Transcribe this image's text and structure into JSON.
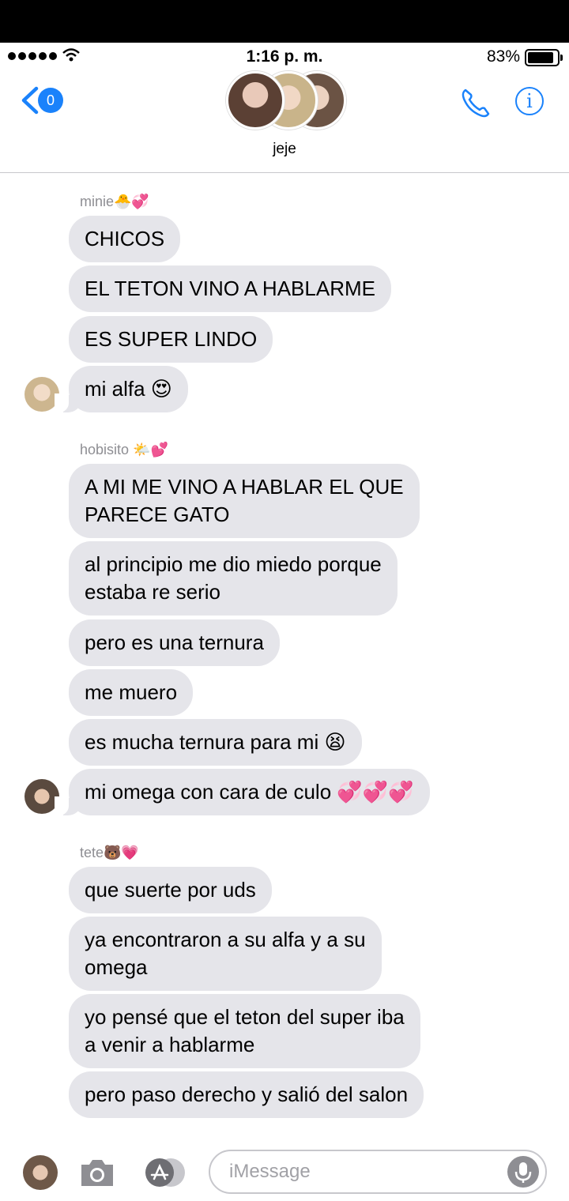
{
  "status_bar": {
    "time": "1:16 p. m.",
    "battery": "83%"
  },
  "header": {
    "back_badge": "0",
    "group_name": "jeje"
  },
  "messages": [
    {
      "sender": "minie🐣💞",
      "bubbles": [
        "CHICOS",
        "EL TETON VINO A HABLARME",
        "ES SUPER LINDO",
        "mi alfa 😍"
      ]
    },
    {
      "sender": "hobisito 🌤️💕",
      "bubbles": [
        "A MI ME VINO A HABLAR EL QUE\nPARECE GATO",
        "al principio me dio miedo porque\nestaba re serio",
        "pero es una ternura",
        "me muero",
        "es mucha ternura para mi 😫",
        "mi omega con cara de culo 💞💞💞"
      ]
    },
    {
      "sender": "tete🐻💗",
      "bubbles": [
        "que suerte por uds",
        "ya encontraron a su alfa y a su\nomega",
        "yo pensé que el teton del super iba\na venir a hablarme",
        "pero paso derecho y salió del salon"
      ]
    }
  ],
  "composer": {
    "placeholder": "iMessage"
  }
}
